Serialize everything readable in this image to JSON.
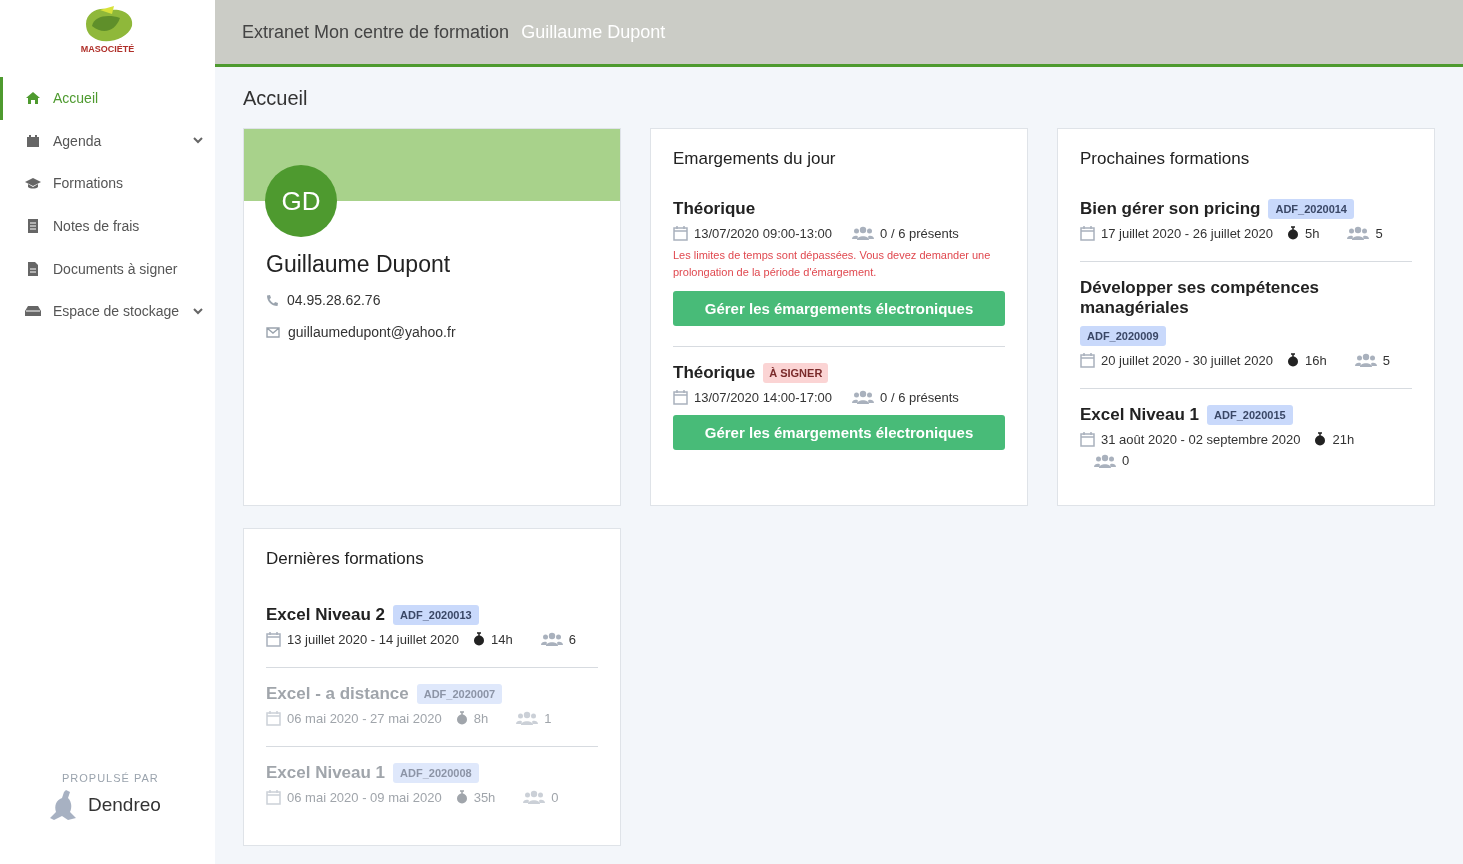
{
  "logo": {
    "text": "MASOCIÉTÉ"
  },
  "sidebar": {
    "items": [
      {
        "kind": "home",
        "label": "Accueil",
        "selected": true,
        "expandable": false
      },
      {
        "kind": "calendar",
        "label": "Agenda",
        "selected": false,
        "expandable": true
      },
      {
        "kind": "training",
        "label": "Formations",
        "selected": false,
        "expandable": false
      },
      {
        "kind": "expenses",
        "label": "Notes de frais",
        "selected": false,
        "expandable": false
      },
      {
        "kind": "documents",
        "label": "Documents à signer",
        "selected": false,
        "expandable": false
      },
      {
        "kind": "storage",
        "label": "Espace de stockage",
        "selected": false,
        "expandable": true
      }
    ],
    "footer": {
      "caption": "PROPULSÉ PAR",
      "brand": "Dendreo"
    }
  },
  "header": {
    "title": "Extranet Mon centre de formation",
    "user": "Guillaume Dupont"
  },
  "page_title": "Accueil",
  "profile": {
    "initials": "GD",
    "name": "Guillaume Dupont",
    "phone": "04.95.28.62.76",
    "email": "guillaumedupont@yahoo.fr"
  },
  "attendance": {
    "title": "Emargements du jour",
    "sessions": [
      {
        "title": "Théorique",
        "datetime": "13/07/2020 09:00-13:00",
        "present": "0 / 6 présents",
        "warning": "Les limites de temps sont dépassées. Vous devez demander une prolongation de la période d'émargement.",
        "button": "Gérer les émargements électroniques"
      },
      {
        "title": "Théorique",
        "badge": "À SIGNER",
        "datetime": "13/07/2020 14:00-17:00",
        "present": "0 / 6 présents",
        "button": "Gérer les émargements électroniques"
      }
    ]
  },
  "upcoming": {
    "title": "Prochaines formations",
    "items": [
      {
        "title": "Bien gérer son pricing",
        "code": "ADF_2020014",
        "dates": "17 juillet 2020 - 26 juillet 2020",
        "duration": "5h",
        "participants": "5",
        "dimmed": false
      },
      {
        "title": "Développer ses compétences managériales",
        "code": "ADF_2020009",
        "dates": "20 juillet 2020 - 30 juillet 2020",
        "duration": "16h",
        "participants": "5",
        "dimmed": false
      },
      {
        "title": "Excel Niveau 1",
        "code": "ADF_2020015",
        "dates": "31 août 2020 - 02 septembre 2020",
        "duration": "21h",
        "participants": "0",
        "dimmed": false
      }
    ]
  },
  "recent": {
    "title": "Dernières formations",
    "items": [
      {
        "title": "Excel Niveau 2",
        "code": "ADF_2020013",
        "dates": "13 juillet 2020 - 14 juillet 2020",
        "duration": "14h",
        "participants": "6",
        "dimmed": false
      },
      {
        "title": "Excel - a distance",
        "code": "ADF_2020007",
        "dates": "06 mai 2020 - 27 mai 2020",
        "duration": "8h",
        "participants": "1",
        "dimmed": true
      },
      {
        "title": "Excel Niveau 1",
        "code": "ADF_2020008",
        "dates": "06 mai 2020 - 09 mai 2020",
        "duration": "35h",
        "participants": "0",
        "dimmed": true
      }
    ]
  }
}
